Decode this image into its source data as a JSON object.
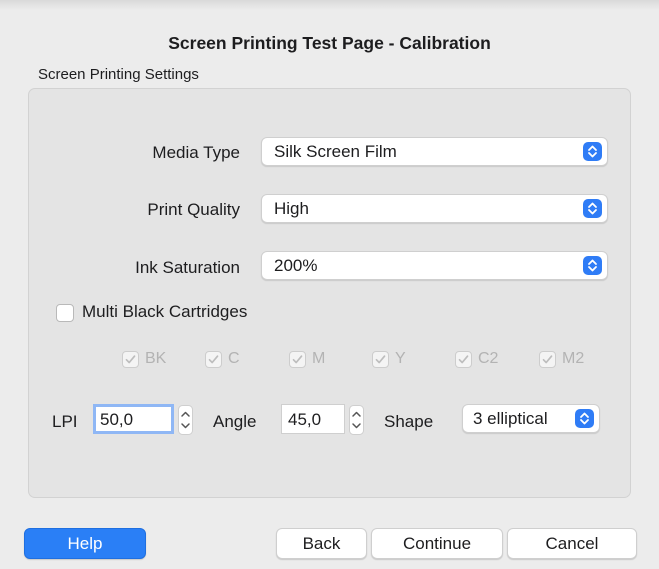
{
  "dialog": {
    "title": "Screen Printing Test Page - Calibration",
    "group_label": "Screen Printing Settings"
  },
  "settings": {
    "media_type": {
      "label": "Media Type",
      "value": "Silk Screen Film"
    },
    "print_quality": {
      "label": "Print Quality",
      "value": "High"
    },
    "ink_saturation": {
      "label": "Ink Saturation",
      "value": "200%"
    }
  },
  "multi_black": {
    "label": "Multi Black Cartridges",
    "checked": false,
    "cartridges": [
      {
        "label": "BK",
        "checked": true,
        "enabled": false
      },
      {
        "label": "C",
        "checked": true,
        "enabled": false
      },
      {
        "label": "M",
        "checked": true,
        "enabled": false
      },
      {
        "label": "Y",
        "checked": true,
        "enabled": false
      },
      {
        "label": "C2",
        "checked": true,
        "enabled": false
      },
      {
        "label": "M2",
        "checked": true,
        "enabled": false
      }
    ]
  },
  "screen": {
    "lpi_label": "LPI",
    "lpi_value": "50,0",
    "angle_label": "Angle",
    "angle_value": "45,0",
    "shape_label": "Shape",
    "shape_value": "3 elliptical"
  },
  "buttons": {
    "help": "Help",
    "back": "Back",
    "continue": "Continue",
    "cancel": "Cancel"
  },
  "colors": {
    "accent": "#2f7cf6",
    "focus_ring": "#8fb7f5",
    "disabled_text": "#b3b3b3"
  },
  "icons": {
    "popup_arrows": "chevron-up-down-icon",
    "stepper": "stepper-arrows-icon",
    "check": "checkmark-icon"
  }
}
